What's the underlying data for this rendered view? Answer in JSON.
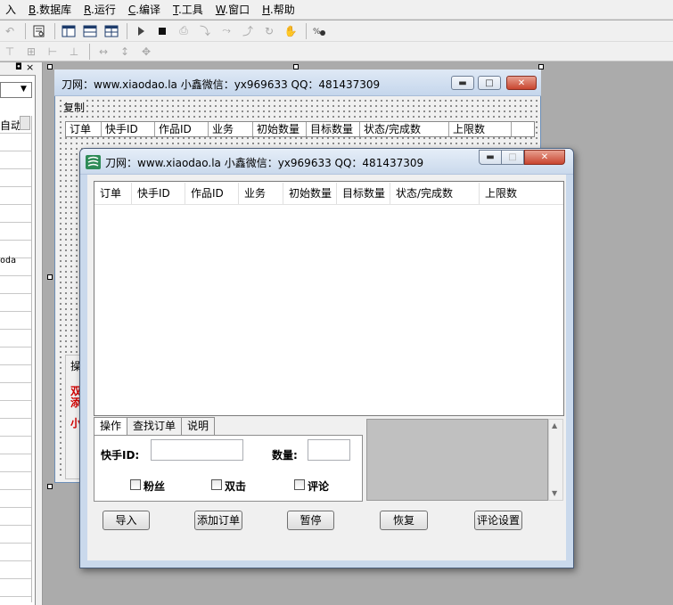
{
  "menubar": {
    "items": [
      {
        "prefix": "",
        "key": "",
        "label": "入"
      },
      {
        "prefix": "",
        "key": "B",
        "label": ".数据库"
      },
      {
        "prefix": "",
        "key": "R",
        "label": ".运行"
      },
      {
        "prefix": "",
        "key": "C",
        "label": ".编译"
      },
      {
        "prefix": "",
        "key": "T",
        "label": ".工具"
      },
      {
        "prefix": "",
        "key": "W",
        "label": ".窗口"
      },
      {
        "prefix": "",
        "key": "H",
        "label": ".帮助"
      }
    ]
  },
  "left_panel": {
    "header_buttons": [
      "◘",
      "×"
    ],
    "list_text_1": "自动",
    "list_text_2": "oda"
  },
  "design_window": {
    "title": "刀网：www.xiaodao.la  小鑫微信：yx969633  QQ：481437309",
    "menu_copy": "复制",
    "columns": [
      "订单",
      "快手ID",
      "作品ID",
      "业务",
      "初始数量",
      "目标数量",
      "状态/完成数",
      "上限数"
    ],
    "group_label_1": "操",
    "group_label_2": "双",
    "group_label_3": "添",
    "group_label_4": "小"
  },
  "run_window": {
    "title": "刀网：www.xiaodao.la  小鑫微信：yx969633  QQ：481437309",
    "columns": [
      "订单",
      "快手ID",
      "作品ID",
      "业务",
      "初始数量",
      "目标数量",
      "状态/完成数",
      "上限数"
    ],
    "tabs": [
      "操作",
      "查找订单",
      "说明"
    ],
    "kuaishou_id_label": "快手ID:",
    "quantity_label": "数量:",
    "kuaishou_id_value": "",
    "quantity_value": "",
    "checkboxes": [
      "粉丝",
      "双击",
      "评论"
    ],
    "buttons": [
      "导入",
      "添加订单",
      "暂停",
      "恢复",
      "评论设置"
    ]
  }
}
